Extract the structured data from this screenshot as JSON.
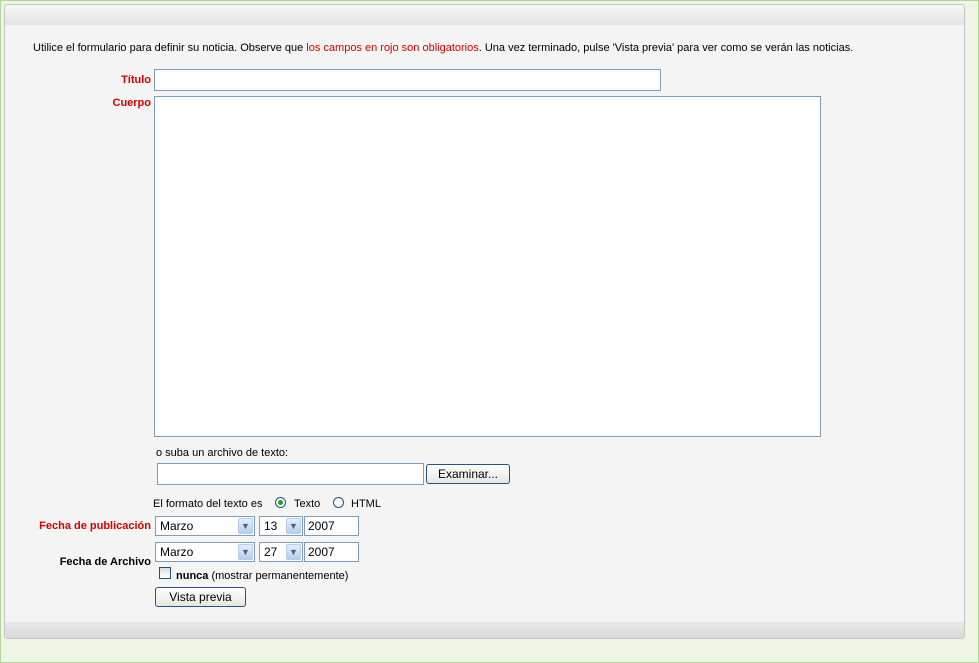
{
  "intro": {
    "before": "Utilice el formulario para definir su noticia. Observe que ",
    "highlight": "los campos en rojo son obligatorios",
    "after": ". Una vez terminado, pulse 'Vista previa' para ver como se verán las noticias."
  },
  "form": {
    "titulo_label": "Título",
    "titulo_value": "",
    "cuerpo_label": "Cuerpo",
    "cuerpo_value": "",
    "upload_label": "o suba un archivo de texto:",
    "file_value": "",
    "examinar_label": "Examinar...",
    "format_label": "El formato del texto es",
    "format_options": {
      "texto": "Texto",
      "html": "HTML"
    },
    "format_selected": "Texto",
    "pub_label": "Fecha de publicación",
    "pub_month": "Marzo",
    "pub_day": "13",
    "pub_year": "2007",
    "arch_label": "Fecha de Archivo",
    "arch_month": "Marzo",
    "arch_day": "27",
    "arch_year": "2007",
    "nunca_bold": "nunca",
    "nunca_rest": " (mostrar permanentemente)",
    "preview_label": "Vista previa"
  },
  "colors": {
    "required": "#d40000",
    "background": "#eef5e4",
    "panel": "#f4f4f4"
  }
}
